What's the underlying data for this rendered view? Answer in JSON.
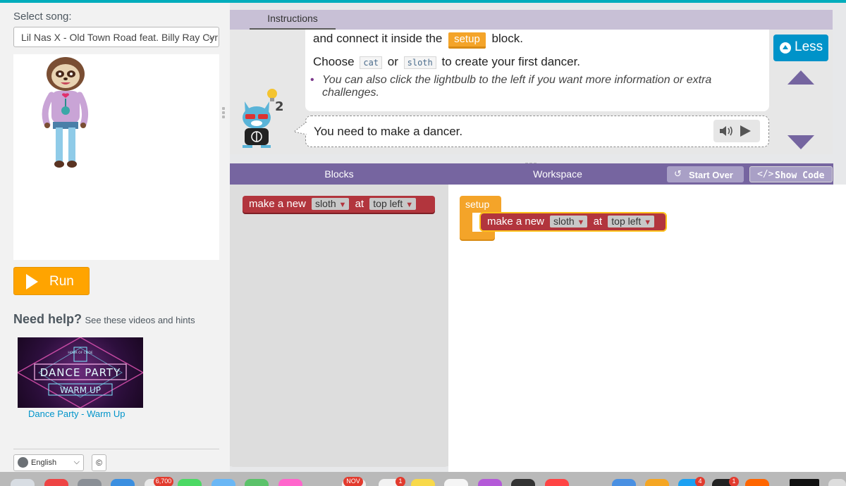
{
  "song": {
    "label": "Select song:",
    "selected": "Lil Nas X - Old Town Road feat. Billy Ray Cyrus"
  },
  "run_label": "Run",
  "help": {
    "title": "Need help?",
    "subtitle": "See these videos and hints",
    "video_thumb_lines": [
      "HOUR OF CODE",
      "DANCE PARTY",
      "WARM UP"
    ],
    "video_title": "Dance Party - Warm Up"
  },
  "language": "English",
  "copyright": "©",
  "instructions": {
    "tab": "Instructions",
    "line1_before": "and connect it inside the",
    "line1_pill": "setup",
    "line1_after": "block.",
    "line2_before": "Choose",
    "code1": "cat",
    "line2_or": "or",
    "code2": "sloth",
    "line2_after": "to create your first dancer.",
    "bullet": "You can also click the lightbulb to the left if you want more information or extra challenges.",
    "lightbulb_count": "2",
    "hint": "You need to make a dancer.",
    "less_label": "Less"
  },
  "editor": {
    "blocks_title": "Blocks",
    "workspace_title": "Workspace",
    "start_over": "Start Over",
    "show_code": "Show Code",
    "block": {
      "prefix": "make a new",
      "dancer": "sloth",
      "at": "at",
      "position": "top left"
    },
    "setup_label": "setup"
  },
  "dock_badges": [
    "6,700",
    "NOV",
    "1",
    "4",
    "1"
  ],
  "colors": {
    "accent_teal": "#00adbc",
    "purple_header": "#7665a0",
    "run_orange": "#ffa400",
    "block_red": "#b2353d",
    "setup_orange": "#f4a429",
    "link_blue": "#0094ca"
  }
}
